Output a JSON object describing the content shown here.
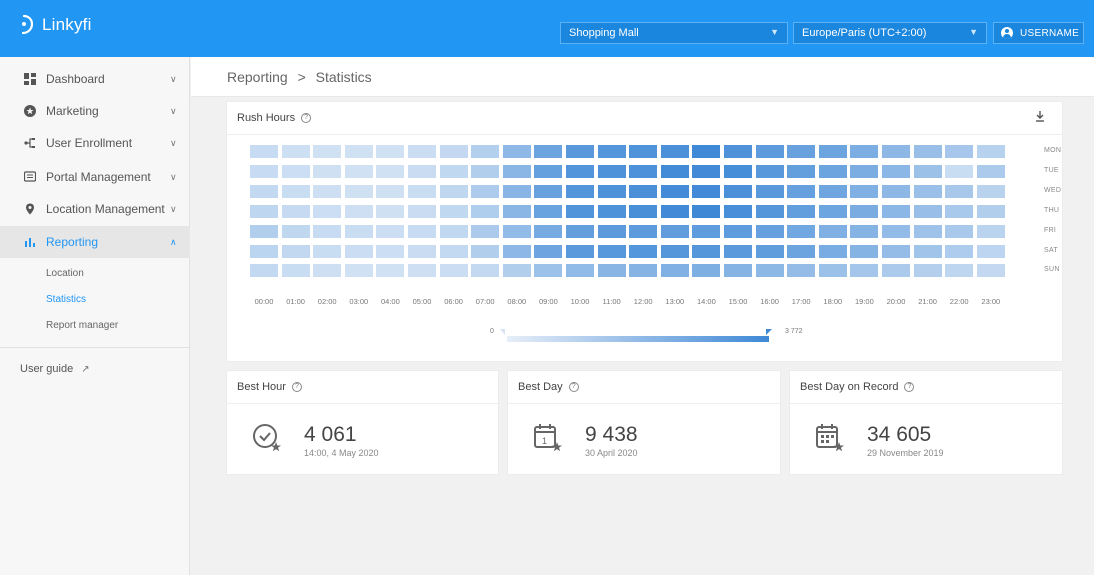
{
  "app": {
    "name": "Linkyfi"
  },
  "topbar": {
    "venue_select": "Shopping Mall",
    "timezone_select": "Europe/Paris (UTC+2:00)",
    "user_label": "USERNAME"
  },
  "sidebar": {
    "items": [
      {
        "label": "Dashboard",
        "icon": "dashboard-icon"
      },
      {
        "label": "Marketing",
        "icon": "star-icon"
      },
      {
        "label": "User Enrollment",
        "icon": "enrollment-icon"
      },
      {
        "label": "Portal Management",
        "icon": "portal-icon"
      },
      {
        "label": "Location Management",
        "icon": "location-pin-icon"
      },
      {
        "label": "Reporting",
        "icon": "bar-chart-icon"
      }
    ],
    "reporting_sub": [
      "Location",
      "Statistics",
      "Report manager"
    ],
    "user_guide": "User guide"
  },
  "breadcrumb": {
    "section": "Reporting",
    "separator": ">",
    "page": "Statistics"
  },
  "rush_hours": {
    "title": "Rush Hours",
    "legend_min": "0",
    "legend_max": "3 772",
    "colors": {
      "low": "#e6eef8",
      "high": "#3e88d6"
    }
  },
  "chart_data": {
    "type": "heatmap",
    "title": "Rush Hours",
    "x": [
      "00:00",
      "01:00",
      "02:00",
      "03:00",
      "04:00",
      "05:00",
      "06:00",
      "07:00",
      "08:00",
      "09:00",
      "10:00",
      "11:00",
      "12:00",
      "13:00",
      "14:00",
      "15:00",
      "16:00",
      "17:00",
      "18:00",
      "19:00",
      "20:00",
      "21:00",
      "22:00",
      "23:00"
    ],
    "y": [
      "MON",
      "TUE",
      "WED",
      "THU",
      "FRI",
      "SAT",
      "SUN"
    ],
    "values": [
      [
        700,
        560,
        470,
        470,
        470,
        630,
        770,
        1140,
        1980,
        2740,
        3170,
        3270,
        3380,
        3460,
        3720,
        3400,
        3060,
        2840,
        2740,
        2380,
        1990,
        1740,
        1440,
        1050
      ],
      [
        700,
        580,
        500,
        470,
        470,
        660,
        820,
        1200,
        2070,
        2930,
        3300,
        3400,
        3450,
        3650,
        3680,
        3560,
        3190,
        2950,
        2740,
        2390,
        2040,
        1670,
        640,
        1310
      ],
      [
        780,
        640,
        550,
        520,
        500,
        670,
        850,
        1270,
        2110,
        2850,
        3290,
        3410,
        3510,
        3640,
        3690,
        3480,
        3180,
        2870,
        2680,
        2300,
        1990,
        1700,
        1420,
        1010
      ],
      [
        900,
        720,
        600,
        540,
        510,
        660,
        820,
        1230,
        2080,
        2820,
        3320,
        3410,
        3530,
        3690,
        3770,
        3550,
        3250,
        2970,
        2710,
        2430,
        2040,
        1730,
        1360,
        1180
      ],
      [
        1200,
        860,
        700,
        640,
        590,
        690,
        820,
        1300,
        1870,
        2500,
        2940,
        3090,
        3070,
        2990,
        3050,
        3030,
        2880,
        2600,
        2320,
        2170,
        1880,
        1610,
        1360,
        990
      ],
      [
        960,
        800,
        680,
        620,
        590,
        660,
        790,
        1200,
        2020,
        2700,
        3150,
        3200,
        3270,
        3250,
        3250,
        3160,
        3000,
        2730,
        2440,
        2200,
        1850,
        1560,
        1260,
        930
      ],
      [
        790,
        640,
        540,
        490,
        470,
        540,
        630,
        790,
        1170,
        1630,
        1930,
        2090,
        2180,
        2270,
        2340,
        2200,
        2010,
        1850,
        1660,
        1490,
        1300,
        1130,
        890,
        760
      ]
    ],
    "min": 0,
    "max": 3772
  },
  "stats": [
    {
      "title": "Best Hour",
      "value": "4 061",
      "sub": "14:00, 4 May 2020",
      "icon": "clock-star-icon"
    },
    {
      "title": "Best Day",
      "value": "9 438",
      "sub": "30 April 2020",
      "icon": "calendar-day-star-icon"
    },
    {
      "title": "Best Day on Record",
      "value": "34 605",
      "sub": "29 November 2019",
      "icon": "calendar-grid-star-icon"
    }
  ]
}
